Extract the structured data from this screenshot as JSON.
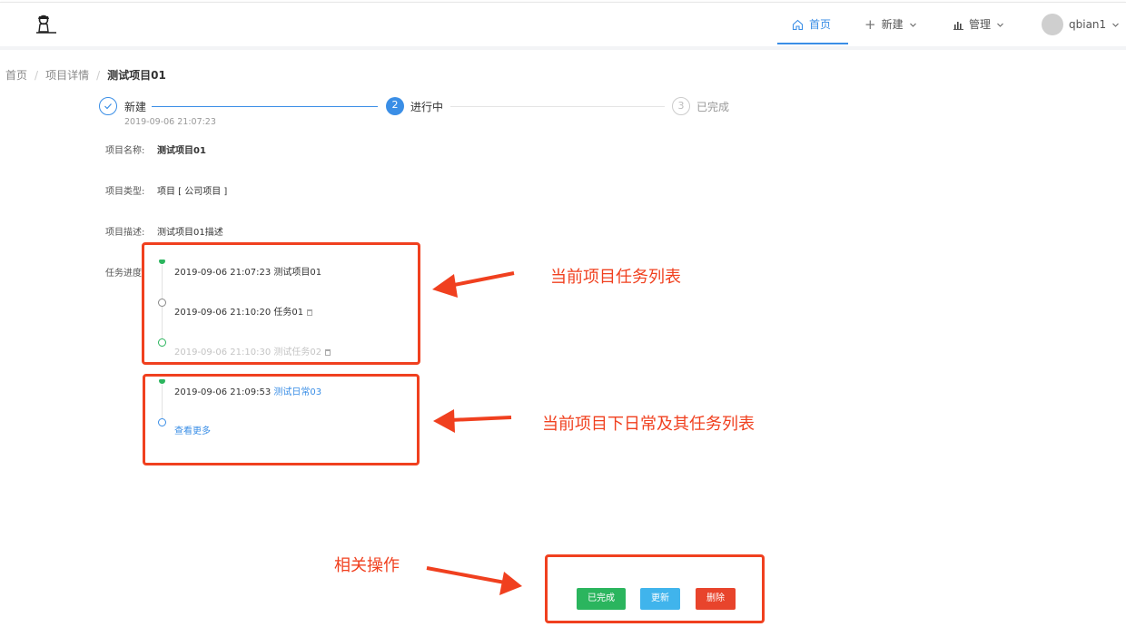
{
  "nav": {
    "home": "首页",
    "new": "新建",
    "manage": "管理",
    "user": "qbian1"
  },
  "breadcrumb": {
    "home": "首页",
    "detail": "项目详情",
    "current": "测试项目01"
  },
  "steps": [
    {
      "label": "新建",
      "time": "2019-09-06 21:07:23",
      "status": "done"
    },
    {
      "label": "进行中",
      "number": "2",
      "status": "active"
    },
    {
      "label": "已完成",
      "number": "3",
      "status": "pending"
    }
  ],
  "fields": {
    "name_label": "项目名称:",
    "name_value": "测试项目01",
    "type_label": "项目类型:",
    "type_value": "项目 [ 公司项目 ]",
    "desc_label": "项目描述:",
    "desc_value": "测试项目01描述",
    "progress_label": "任务进度:"
  },
  "task_timeline": [
    {
      "time": "2019-09-06 21:07:23",
      "name": "测试项目01"
    },
    {
      "time": "2019-09-06 21:10:20",
      "name": "任务01"
    },
    {
      "time": "2019-09-06 21:10:30",
      "name": "测试任务02"
    }
  ],
  "routine_timeline": {
    "time": "2019-09-06 21:09:53",
    "link": "测试日常03",
    "more": "查看更多"
  },
  "annotations": {
    "task_list": "当前项目任务列表",
    "routine_list": "当前项目下日常及其任务列表",
    "actions": "相关操作"
  },
  "actions": {
    "complete": "已完成",
    "update": "更新",
    "delete": "删除"
  },
  "colors": {
    "accent": "#3a8ee6",
    "annotation": "#f0401f",
    "complete_btn": "#2bb55e",
    "update_btn": "#40b4ec",
    "delete_btn": "#e8442c"
  }
}
